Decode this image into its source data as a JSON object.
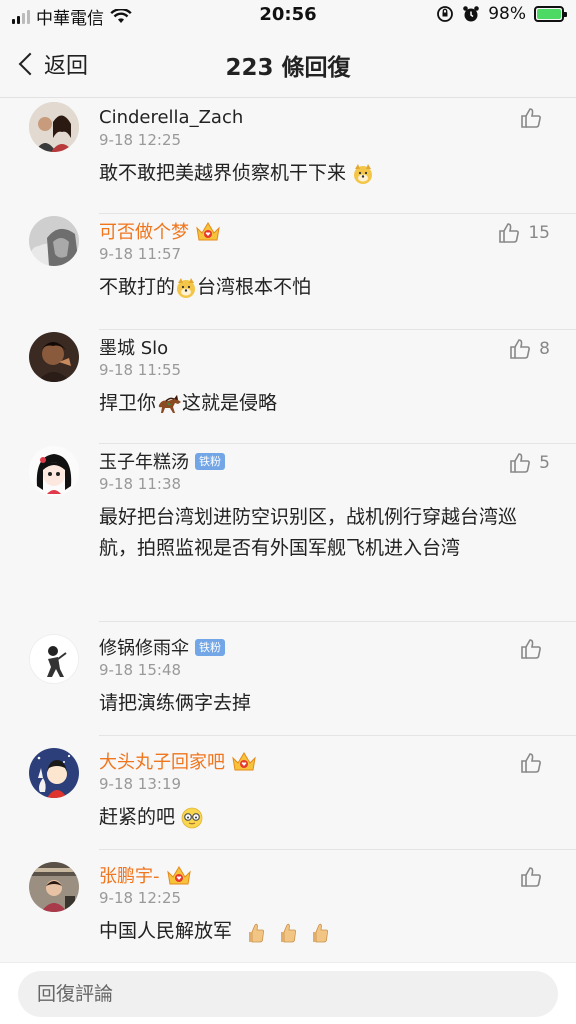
{
  "status_bar": {
    "carrier": "中華電信",
    "time": "20:56",
    "battery": "98%",
    "battery_level": 0.98
  },
  "nav": {
    "back_label": "返回",
    "title": "223 條回復"
  },
  "comments": [
    {
      "username": "Cinderella_Zach",
      "timestamp": "9-18 12:25",
      "text": "敢不敢把美越界侦察机干下来",
      "likes": ""
    },
    {
      "username": "可否做个梦",
      "timestamp": "9-18 11:57",
      "text_before": "不敢打的",
      "text_after": "台湾根本不怕",
      "likes": "15"
    },
    {
      "username": "墨城 Slo",
      "timestamp": "9-18 11:55",
      "text_before": "捍卫你",
      "text_after": "这就是侵略",
      "likes": "8"
    },
    {
      "username": "玉子年糕汤",
      "badge": "铁粉",
      "timestamp": "9-18 11:38",
      "text": "最好把台湾划进防空识别区，战机例行穿越台湾巡航，拍照监视是否有外国军舰飞机进入台湾",
      "likes": "5"
    },
    {
      "username": "修锅修雨伞",
      "badge": "铁粉",
      "timestamp": "9-18 15:48",
      "text": "请把演练俩字去掉",
      "likes": ""
    },
    {
      "username": "大头丸子回家吧",
      "timestamp": "9-18 13:19",
      "text": "赶紧的吧",
      "likes": ""
    },
    {
      "username": "张鹏宇-",
      "timestamp": "9-18 12:25",
      "text": "中国人民解放军",
      "likes": ""
    }
  ],
  "reply": {
    "placeholder": "回復評論"
  },
  "colors": {
    "accent_orange": "#f0761d",
    "badge_blue": "#72a6e6",
    "battery_green": "#4cd964"
  }
}
